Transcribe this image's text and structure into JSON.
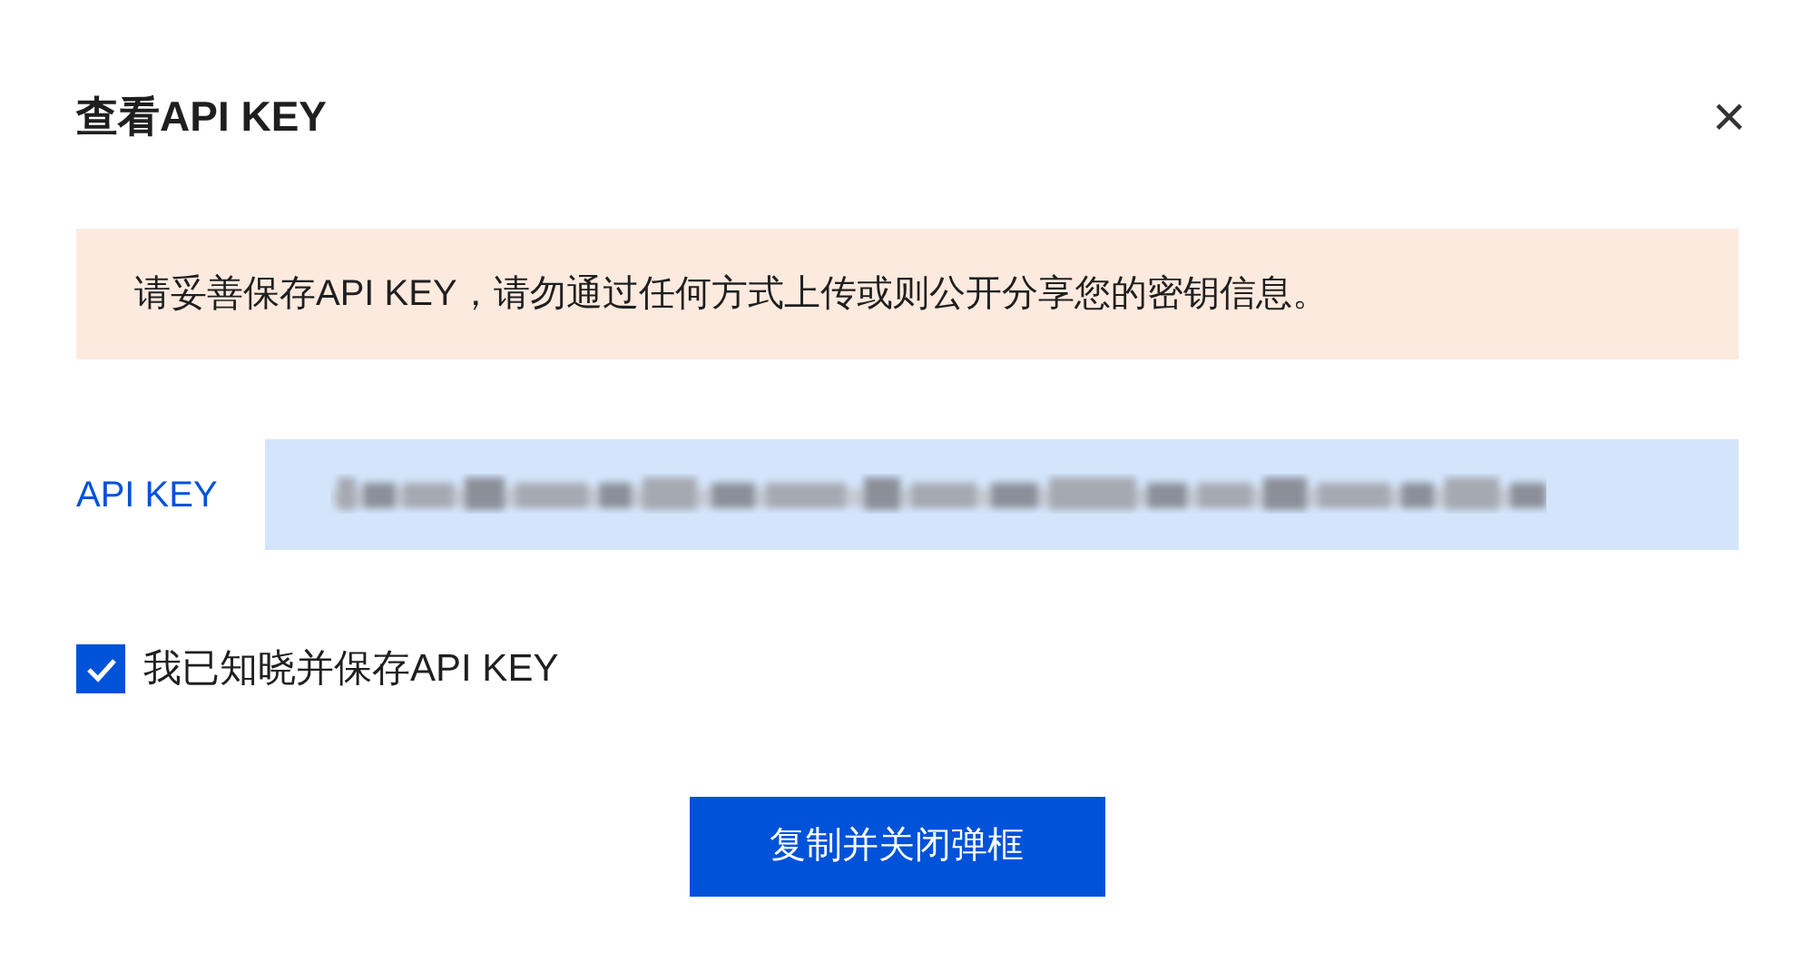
{
  "dialog": {
    "title": "查看API KEY",
    "close": "×"
  },
  "notice": "请妥善保存API KEY，请勿通过任何方式上传或则公开分享您的密钥信息。",
  "key_field": {
    "label": "API KEY",
    "redacted": true
  },
  "acknowledge": {
    "label": "我已知晓并保存API KEY",
    "checked": true
  },
  "primary_button": "复制并关闭弹框"
}
